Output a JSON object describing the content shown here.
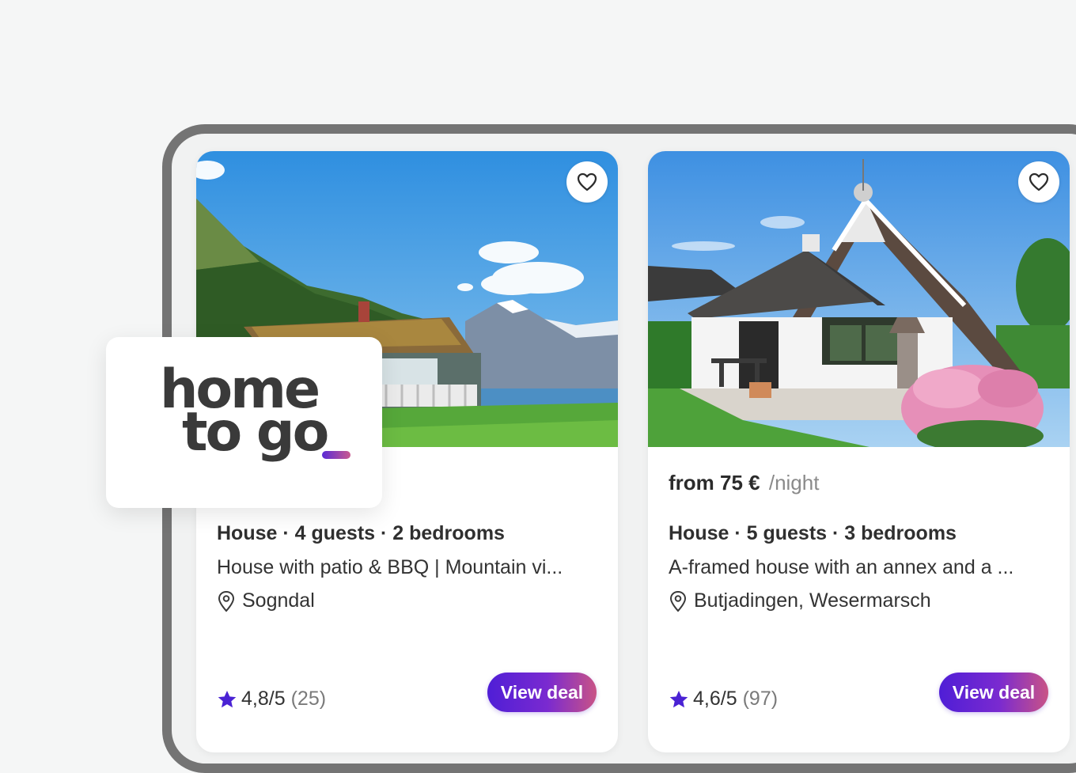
{
  "brand": {
    "name": "hometogo",
    "logo_line_1": "home",
    "logo_line_2": "to go",
    "accent_gradient": [
      "#4f1ed6",
      "#c95386"
    ]
  },
  "listings": [
    {
      "price_text": "",
      "per_night": "",
      "title": "House · 4 guests · 2 bedrooms",
      "description": "House with patio & BBQ | Mountain vi...",
      "location": "Sogndal",
      "rating": "4,8/5",
      "reviews": "(25)",
      "cta": "View deal",
      "favorite_icon": "heart-outline-icon",
      "photo_icon": "lakeside-cabin-photo"
    },
    {
      "price_text": "from 75 €",
      "per_night": "/night",
      "title": "House · 5 guests · 3 bedrooms",
      "description": "A-framed house with an annex and a ...",
      "location": "Butjadingen, Wesermarsch",
      "rating": "4,6/5",
      "reviews": "(97)",
      "cta": "View deal",
      "favorite_icon": "heart-outline-icon",
      "photo_icon": "a-frame-house-photo"
    }
  ],
  "colors": {
    "star": "#4a22d4",
    "frame": "#747474",
    "background": "#f5f6f6"
  }
}
